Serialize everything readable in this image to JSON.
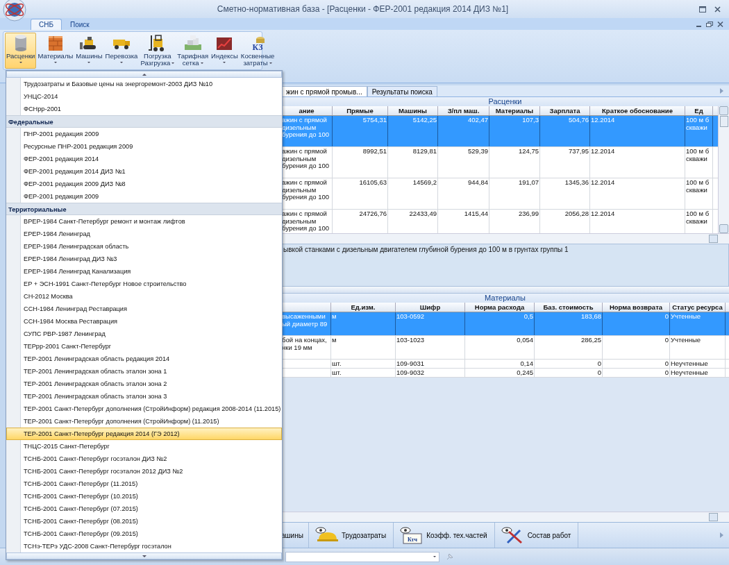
{
  "window": {
    "title": "Сметно-нормативная база - [Расценки - ФЕР-2001 редакция 2014 ДИЗ №1]"
  },
  "ribbon_tabs": [
    {
      "label": "СНБ",
      "selected": true
    },
    {
      "label": "Поиск",
      "selected": false
    }
  ],
  "ribbon_buttons": [
    {
      "kind": "database",
      "lines": [
        "Расценки"
      ],
      "selected": true
    },
    {
      "kind": "bricks",
      "lines": [
        "Материалы"
      ],
      "selected": false
    },
    {
      "kind": "bulldozer",
      "lines": [
        "Машины"
      ],
      "selected": false
    },
    {
      "kind": "truck",
      "lines": [
        "Перевозка"
      ],
      "selected": false
    },
    {
      "kind": "forklift",
      "lines": [
        "Погрузка",
        "Разгрузка"
      ],
      "selected": false
    },
    {
      "kind": "money",
      "lines": [
        "Тарифная",
        "сетка"
      ],
      "selected": false
    },
    {
      "kind": "chart",
      "lines": [
        "Индексы"
      ],
      "selected": false
    },
    {
      "kind": "coins",
      "lines": [
        "Косвенные",
        "затраты"
      ],
      "selected": false,
      "icon_text": "КЗ"
    }
  ],
  "menu": {
    "items": [
      {
        "kind": "item",
        "label": "Трудозатраты и Базовые цены на энергоремонт-2003 ДИЗ №10",
        "selected": false
      },
      {
        "kind": "item",
        "label": "УНЦС-2014",
        "selected": false
      },
      {
        "kind": "item",
        "label": "ФСНрр-2001",
        "selected": false
      },
      {
        "kind": "header",
        "label": "Федеральные"
      },
      {
        "kind": "item",
        "label": "ПНР-2001 редакция 2009",
        "selected": false
      },
      {
        "kind": "item",
        "label": "Ресурсные ПНР-2001 редакция 2009",
        "selected": false
      },
      {
        "kind": "item",
        "label": "ФЕР-2001 редакция 2014",
        "selected": false
      },
      {
        "kind": "item",
        "label": "ФЕР-2001 редакция 2014 ДИЗ №1",
        "selected": false
      },
      {
        "kind": "item",
        "label": "ФЕР-2001 редакция 2009 ДИЗ №8",
        "selected": false
      },
      {
        "kind": "item",
        "label": "ФЕР-2001 редакция 2009",
        "selected": false
      },
      {
        "kind": "header",
        "label": "Территориальные"
      },
      {
        "kind": "item",
        "label": "ВРЕР-1984 Санкт-Петербург ремонт и монтаж лифтов",
        "selected": false
      },
      {
        "kind": "item",
        "label": "ЕРЕР-1984 Ленинград",
        "selected": false
      },
      {
        "kind": "item",
        "label": "ЕРЕР-1984 Ленинградская область",
        "selected": false
      },
      {
        "kind": "item",
        "label": "ЕРЕР-1984 Ленинград ДИЗ №3",
        "selected": false
      },
      {
        "kind": "item",
        "label": "ЕРЕР-1984 Ленинград Канализация",
        "selected": false
      },
      {
        "kind": "item",
        "label": "ЕР + ЭСН-1991 Санкт-Петербург Новое строительство",
        "selected": false
      },
      {
        "kind": "item",
        "label": "СН-2012 Москва",
        "selected": false
      },
      {
        "kind": "item",
        "label": "ССН-1984 Ленинград Реставрация",
        "selected": false
      },
      {
        "kind": "item",
        "label": "ССН-1984 Москва Реставрация",
        "selected": false
      },
      {
        "kind": "item",
        "label": "СУПС РВР-1987 Ленинград",
        "selected": false
      },
      {
        "kind": "item",
        "label": "ТЕРрр-2001 Санкт-Петербург",
        "selected": false
      },
      {
        "kind": "item",
        "label": "ТЕР-2001 Ленинградская область редакция 2014",
        "selected": false
      },
      {
        "kind": "item",
        "label": "ТЕР-2001 Ленинградская область эталон зона 1",
        "selected": false
      },
      {
        "kind": "item",
        "label": "ТЕР-2001 Ленинградская область эталон зона 2",
        "selected": false
      },
      {
        "kind": "item",
        "label": "ТЕР-2001 Ленинградская область эталон зона 3",
        "selected": false
      },
      {
        "kind": "item",
        "label": "ТЕР-2001 Санкт-Петербург дополнения (СтройИнформ) редакция 2008-2014 (11.2015)",
        "selected": false
      },
      {
        "kind": "item",
        "label": "ТЕР-2001 Санкт-Петербург дополнения (СтройИнформ) (11.2015)",
        "selected": false
      },
      {
        "kind": "item",
        "label": "ТЕР-2001 Санкт-Петербург редакция 2014 (ГЭ 2012)",
        "selected": true
      },
      {
        "kind": "item",
        "label": "ТНЦС-2015 Санкт-Петербург",
        "selected": false
      },
      {
        "kind": "item",
        "label": "ТСНБ-2001 Санкт-Петербург госэталон ДИЗ №2",
        "selected": false
      },
      {
        "kind": "item",
        "label": "ТСНБ-2001 Санкт-Петербург госэталон 2012 ДИЗ №2",
        "selected": false
      },
      {
        "kind": "item",
        "label": "ТСНБ-2001 Санкт-Петербург (11.2015)",
        "selected": false
      },
      {
        "kind": "item",
        "label": "ТСНБ-2001 Санкт-Петербург (10.2015)",
        "selected": false
      },
      {
        "kind": "item",
        "label": "ТСНБ-2001 Санкт-Петербург (07.2015)",
        "selected": false
      },
      {
        "kind": "item",
        "label": "ТСНБ-2001 Санкт-Петербург (08.2015)",
        "selected": false
      },
      {
        "kind": "item",
        "label": "ТСНБ-2001 Санкт-Петербург (09.2015)",
        "selected": false
      },
      {
        "kind": "item",
        "label": "ТСНэ-ТЕРэ УДС-2008 Санкт-Петербург госэталон",
        "selected": false
      }
    ]
  },
  "document_tabs": [
    {
      "label": "жин с прямой промыв...",
      "selected": true
    },
    {
      "label": "Результаты поиска",
      "selected": false
    }
  ],
  "rates": {
    "title": "Расценки",
    "columns": [
      "ание",
      "Прямые",
      "Машины",
      "З/пл маш.",
      "Материалы",
      "Зарплата",
      "Краткое обоснование",
      "Ед"
    ],
    "rows": [
      {
        "selected": true,
        "cells": [
          "ажин с прямой\nдизельным\nбурения до 100",
          "5754,31",
          "5142,25",
          "402,47",
          "107,3",
          "504,76",
          "12.2014",
          "100 м б\nскважи"
        ]
      },
      {
        "selected": false,
        "cells": [
          "ажин с прямой\nдизельным\nбурения до 100",
          "8992,51",
          "8129,81",
          "529,39",
          "124,75",
          "737,95",
          "12.2014",
          "100 м б\nскважи"
        ]
      },
      {
        "selected": false,
        "cells": [
          "ажин с прямой\nдизельным\nбурения до 100",
          "16105,63",
          "14569,2",
          "944,84",
          "191,07",
          "1345,36",
          "12.2014",
          "100 м б\nскважи"
        ]
      },
      {
        "selected": false,
        "cells": [
          "ажин с прямой\nдизельным\nбурения до 100",
          "24726,76",
          "22433,49",
          "1415,44",
          "236,99",
          "2056,28",
          "12.2014",
          "100 м б\nскважи"
        ]
      }
    ]
  },
  "description": "ывкой станками с дизельным двигателем глубиной бурения до 100 м в грунтах группы 1",
  "materials": {
    "title": "Материалы",
    "columns": [
      "Ед.изм.",
      "Шифр",
      "Норма расхода",
      "Баз. стоимость",
      "Норма возврата",
      "Статус ресурса"
    ],
    "rows": [
      {
        "selected": true,
        "name": "высаженными\nый диаметр 89",
        "cells": [
          "м",
          "103-0592",
          "0,5",
          "183,68",
          "0",
          "Учтенные"
        ]
      },
      {
        "selected": false,
        "name": "бой на концах,\nнки 19 мм",
        "cells": [
          "м",
          "103-1023",
          "0,054",
          "286,25",
          "0",
          "Учтенные"
        ]
      },
      {
        "selected": false,
        "cells": [
          "шт.",
          "109-9031",
          "0,14",
          "0",
          "0",
          "Неучтенные"
        ]
      },
      {
        "selected": false,
        "cells": [
          "шт.",
          "109-9032",
          "0,245",
          "0",
          "0",
          "Неучтенные"
        ]
      }
    ]
  },
  "bottom_tabs": [
    {
      "kind": "plain",
      "label": "ашины"
    },
    {
      "kind": "helmet",
      "label": "Трудозатраты"
    },
    {
      "kind": "book",
      "label": "Коэфф. тех.частей",
      "icon_text": "Ктч"
    },
    {
      "kind": "tools",
      "label": "Состав работ"
    }
  ]
}
